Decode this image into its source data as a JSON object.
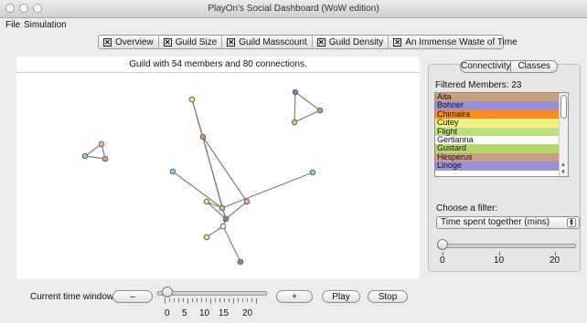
{
  "window": {
    "title": "PlayOn's Social Dashboard (WoW edition)"
  },
  "menu": {
    "items": [
      "File",
      "Simulation"
    ]
  },
  "tabs": [
    {
      "label": "Overview",
      "checked": true
    },
    {
      "label": "Guild Size",
      "checked": true
    },
    {
      "label": "Guild Masscount",
      "checked": true
    },
    {
      "label": "Guild Density",
      "checked": true
    },
    {
      "label": "An Immense Waste of Time",
      "checked": true
    }
  ],
  "graph": {
    "caption": "Guild with 54 members and 80 connections.",
    "colors": {
      "yellow": "#f7e26a",
      "brown": "#c9956a",
      "purple": "#8d7ac9",
      "lavender": "#b6a5de",
      "cyan": "#7fd3e6",
      "orange": "#f0a05a",
      "pink": "#f3a2c0",
      "green": "#a9d87d",
      "white": "#ffffff",
      "edge": "#7f7f7f"
    }
  },
  "time_window": {
    "label": "Current time window:",
    "minus_label": "–",
    "plus_label": "+",
    "play_label": "Play",
    "stop_label": "Stop",
    "slider_ticks": [
      "0",
      "5",
      "10",
      "15",
      "20"
    ],
    "slider_value": 0
  },
  "right_panel": {
    "tabs": [
      "Connectivity",
      "Classes"
    ],
    "selected_tab": "Connectivity",
    "filtered_members_label": "Filtered Members: 23",
    "members": [
      {
        "name": "Aita",
        "color": "#c9a07d"
      },
      {
        "name": "Bohner",
        "color": "#9a8fd8"
      },
      {
        "name": "Chimaira",
        "color": "#ff8c1a"
      },
      {
        "name": "Cutey",
        "color": "#f7ef86"
      },
      {
        "name": "Flight",
        "color": "#b9e07d"
      },
      {
        "name": "Gertianna",
        "color": "#ffffff"
      },
      {
        "name": "Gustard",
        "color": "#b5d66a"
      },
      {
        "name": "Hesperus",
        "color": "#c9a07d"
      },
      {
        "name": "Linoge",
        "color": "#9a8fd8"
      }
    ],
    "filter_label": "Choose a filter:",
    "filter_value": "Time spent together (mins)",
    "filter_slider_ticks": [
      "0",
      "10",
      "20"
    ],
    "filter_slider_value": 0
  }
}
